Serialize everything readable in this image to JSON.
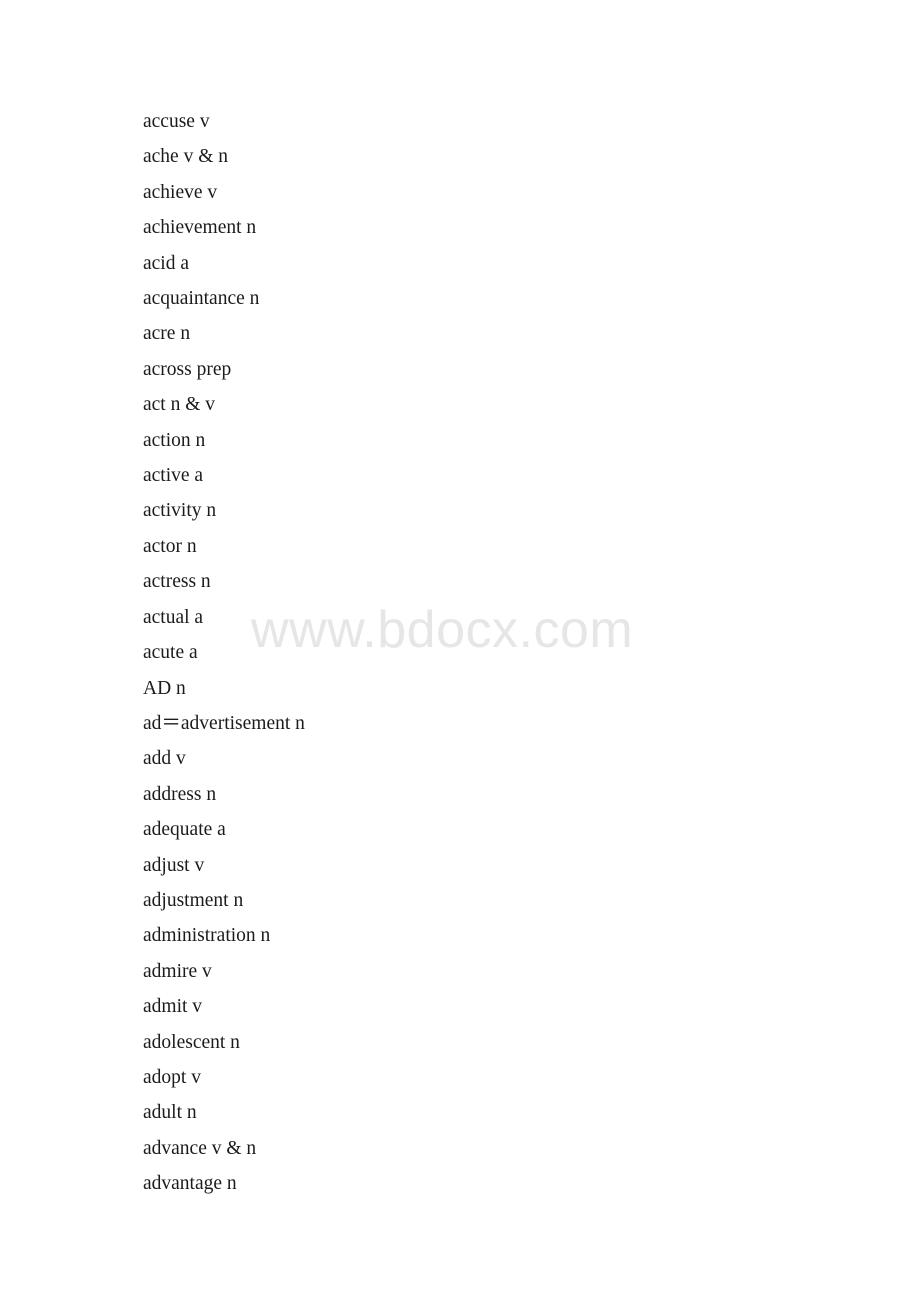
{
  "document": {
    "type": "vocabulary-word-list",
    "page_background": "#ffffff",
    "text_color": "#1b1b1b",
    "watermark": {
      "text": "www.bdocx.com",
      "color": "#e6e6e6"
    },
    "entries": [
      {
        "word": "accuse",
        "pos": "v",
        "text": "accuse v"
      },
      {
        "word": "ache",
        "pos": "v & n",
        "text": "ache v & n"
      },
      {
        "word": "achieve",
        "pos": "v",
        "text": "achieve v"
      },
      {
        "word": "achievement",
        "pos": "n",
        "text": "achievement n"
      },
      {
        "word": "acid",
        "pos": "a",
        "text": "acid a"
      },
      {
        "word": "acquaintance",
        "pos": "n",
        "text": "acquaintance n"
      },
      {
        "word": "acre",
        "pos": "n",
        "text": "acre n"
      },
      {
        "word": "across",
        "pos": "prep",
        "text": "across prep"
      },
      {
        "word": "act",
        "pos": "n & v",
        "text": "act n & v"
      },
      {
        "word": "action",
        "pos": "n",
        "text": "action n"
      },
      {
        "word": "active",
        "pos": "a",
        "text": "active a"
      },
      {
        "word": "activity",
        "pos": "n",
        "text": "activity n"
      },
      {
        "word": "actor",
        "pos": "n",
        "text": "actor n"
      },
      {
        "word": "actress",
        "pos": "n",
        "text": "actress n"
      },
      {
        "word": "actual",
        "pos": "a",
        "text": "actual a"
      },
      {
        "word": "acute",
        "pos": "a",
        "text": "acute a"
      },
      {
        "word": "AD",
        "pos": "n",
        "text": "AD n"
      },
      {
        "word": "ad＝advertisement",
        "pos": "n",
        "text": "ad＝advertisement n"
      },
      {
        "word": "add",
        "pos": "v",
        "text": "add v"
      },
      {
        "word": "address",
        "pos": "n",
        "text": "address n"
      },
      {
        "word": "adequate",
        "pos": "a",
        "text": "adequate a"
      },
      {
        "word": "adjust",
        "pos": "v",
        "text": "adjust v"
      },
      {
        "word": "adjustment",
        "pos": "n",
        "text": "adjustment n"
      },
      {
        "word": "administration",
        "pos": "n",
        "text": "administration n"
      },
      {
        "word": "admire",
        "pos": "v",
        "text": "admire v"
      },
      {
        "word": "admit",
        "pos": "v",
        "text": "admit v"
      },
      {
        "word": "adolescent",
        "pos": "n",
        "text": "adolescent n"
      },
      {
        "word": "adopt",
        "pos": "v",
        "text": "adopt v"
      },
      {
        "word": "adult",
        "pos": "n",
        "text": "adult n"
      },
      {
        "word": "advance",
        "pos": "v & n",
        "text": "advance v & n"
      },
      {
        "word": "advantage",
        "pos": "n",
        "text": "advantage n"
      }
    ]
  }
}
